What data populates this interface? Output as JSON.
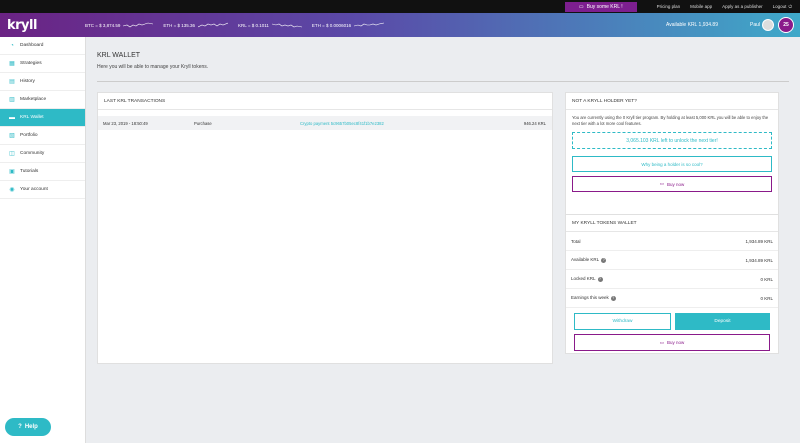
{
  "topbar": {
    "buy_label": "Buy some KRL !",
    "links": [
      "Pricing plan",
      "Mobile app",
      "Apply as a publisher",
      "Logout"
    ]
  },
  "header": {
    "logo": "kryll",
    "ticker": [
      {
        "label": "BTC = $ 3,874.59",
        "trend": "up"
      },
      {
        "label": "ETH = $ 135.36",
        "trend": "up"
      },
      {
        "label": "KRL = $ 0.1011",
        "trend": "down"
      },
      {
        "label": "ETH = $ 0.0006016",
        "trend": "up"
      }
    ],
    "available": "Available KRL 1,934.89",
    "username": "Paul",
    "level": "25"
  },
  "sidebar": {
    "items": [
      {
        "label": "Dashboard",
        "icon": "dashboard-icon",
        "glyph": "◔"
      },
      {
        "label": "Strategies",
        "icon": "strategies-icon",
        "glyph": "▦"
      },
      {
        "label": "History",
        "icon": "history-icon",
        "glyph": "▤"
      },
      {
        "label": "Marketplace",
        "icon": "marketplace-icon",
        "glyph": "▥"
      },
      {
        "label": "KRL Wallet",
        "icon": "wallet-icon",
        "glyph": "▬",
        "active": true
      },
      {
        "label": "Portfolio",
        "icon": "portfolio-icon",
        "glyph": "▧"
      },
      {
        "label": "Community",
        "icon": "community-icon",
        "glyph": "◫"
      },
      {
        "label": "Tutorials",
        "icon": "tutorials-icon",
        "glyph": "▣"
      },
      {
        "label": "Your account",
        "icon": "account-icon",
        "glyph": "◉"
      }
    ],
    "help_label": "Help"
  },
  "main": {
    "title": "KRL WALLET",
    "subtitle": "Here you will be able to manage your Kryll tokens."
  },
  "transactions": {
    "header": "LAST KRL TRANSACTIONS",
    "rows": [
      {
        "date": "Mar 23, 2019 - 18:50:49",
        "type": "Purchase",
        "detail": "Crypto payment 5c9657b05ec8f41f1b7e2382",
        "amount": "946.24 KRL"
      }
    ]
  },
  "promo": {
    "header": "NOT A KRYLL HOLDER YET?",
    "text": "You are currently using the 0 Kryll tier program. By holding at least 5,000 KRL you will be able to enjoy the next tier with a lot more cool features.",
    "unlock": "3,065.103 KRL left to unlock the next tier!",
    "why_label": "Why being a holder is so cool?",
    "buy_label": "Buy now"
  },
  "wallet": {
    "header": "MY KRYLL TOKENS WALLET",
    "rows": [
      {
        "label": "Total",
        "value": "1,934.89 KRL",
        "info": false
      },
      {
        "label": "Available KRL",
        "value": "1,934.89 KRL",
        "info": true
      },
      {
        "label": "Locked KRL",
        "value": "0 KRL",
        "info": true
      },
      {
        "label": "Earnings this week",
        "value": "0 KRL",
        "info": true
      }
    ],
    "withdraw_label": "Withdraw",
    "deposit_label": "Deposit",
    "buy_label": "Buy now"
  },
  "colors": {
    "accent": "#2ebac6",
    "brand": "#8a1a8a"
  }
}
